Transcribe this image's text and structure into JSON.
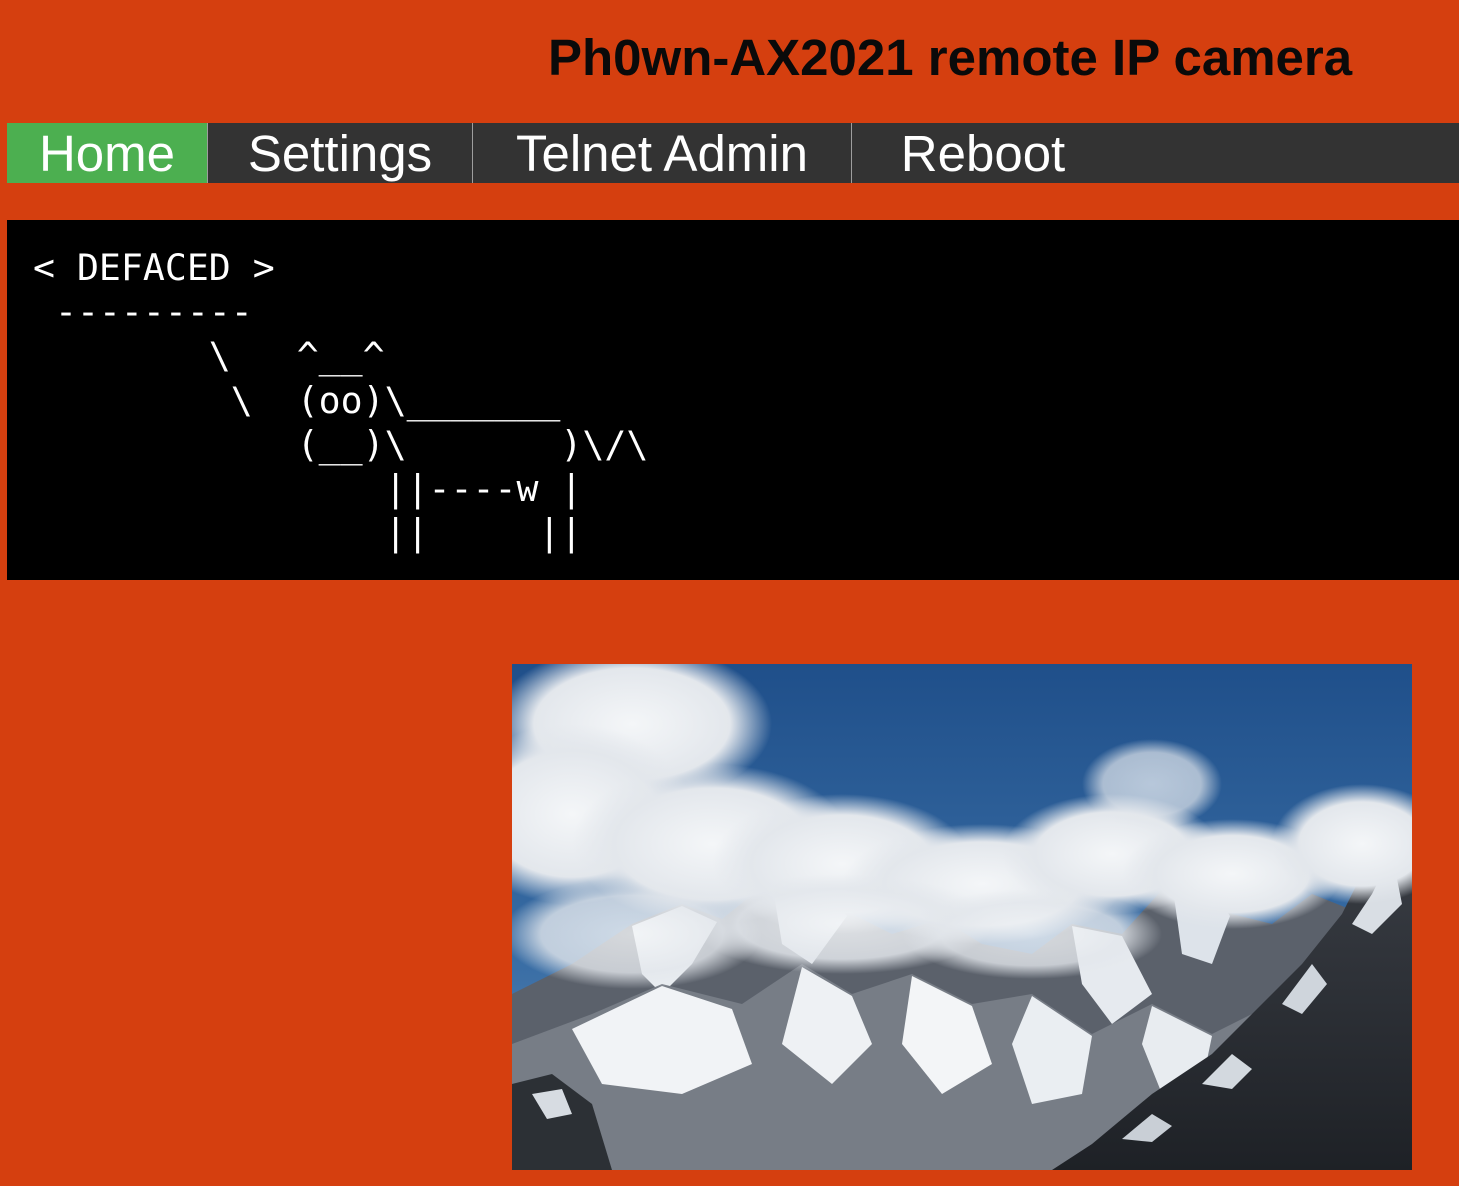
{
  "page": {
    "title": "Ph0wn-AX2021 remote IP camera"
  },
  "nav": {
    "items": [
      {
        "label": "Home",
        "active": true
      },
      {
        "label": "Settings",
        "active": false
      },
      {
        "label": "Telnet Admin",
        "active": false
      },
      {
        "label": "Reboot",
        "active": false
      }
    ]
  },
  "deface": {
    "ascii_art": "< DEFACED >\n ---------\n        \\   ^__^\n         \\  (oo)\\_______\n            (__)\\       )\\/\\\n                ||----w |\n                ||     ||"
  },
  "camera": {
    "image_description": "snow-mountain-cloud-feed"
  },
  "colors": {
    "background": "#d53f0f",
    "nav_background": "#333333",
    "nav_active": "#4caf50",
    "nav_text": "#ffffff",
    "deface_background": "#000000",
    "deface_text": "#ffffff"
  }
}
